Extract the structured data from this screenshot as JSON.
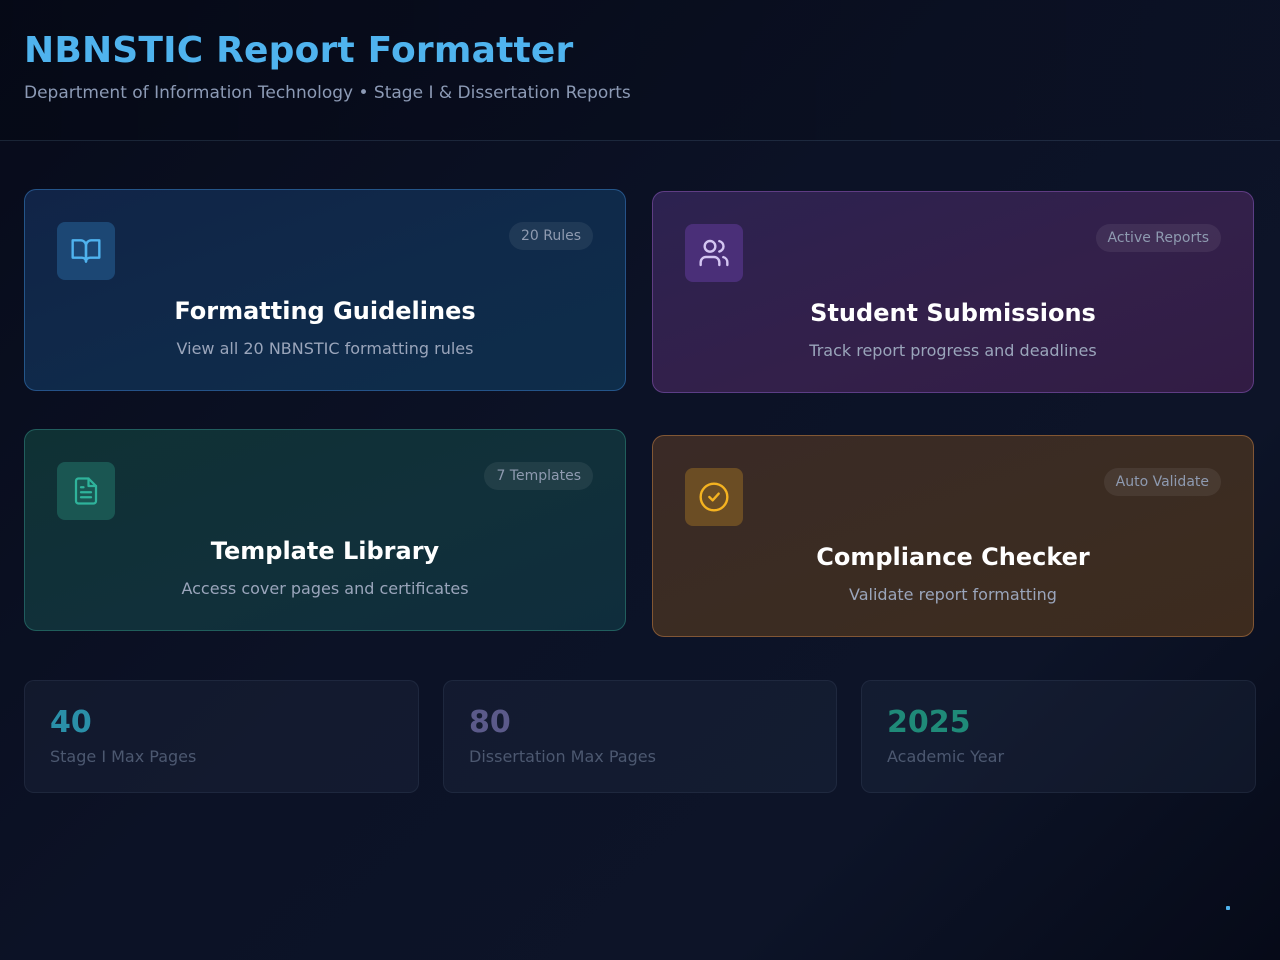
{
  "header": {
    "title": "NBNSTIC Report Formatter",
    "subtitle": "Department of Information Technology • Stage I & Dissertation Reports"
  },
  "cards": [
    {
      "title": "Formatting Guidelines",
      "description": "View all 20 NBNSTIC formatting rules",
      "badge": "20 Rules",
      "icon": "book-open-icon",
      "accent": "#4fb3ee"
    },
    {
      "title": "Student Submissions",
      "description": "Track report progress and deadlines",
      "badge": "Active Reports",
      "icon": "users-icon",
      "accent": "#c9b8f0"
    },
    {
      "title": "Template Library",
      "description": "Access cover pages and certificates",
      "badge": "7 Templates",
      "icon": "file-text-icon",
      "accent": "#2fb39b"
    },
    {
      "title": "Compliance Checker",
      "description": "Validate report formatting",
      "badge": "Auto Validate",
      "icon": "check-circle-icon",
      "accent": "#f5b320"
    }
  ],
  "stats": [
    {
      "value": "40",
      "label": "Stage I Max Pages",
      "color": "#2a8fa8"
    },
    {
      "value": "80",
      "label": "Dissertation Max Pages",
      "color": "#5b5a8a"
    },
    {
      "value": "2025",
      "label": "Academic Year",
      "color": "#1f8a78"
    }
  ]
}
